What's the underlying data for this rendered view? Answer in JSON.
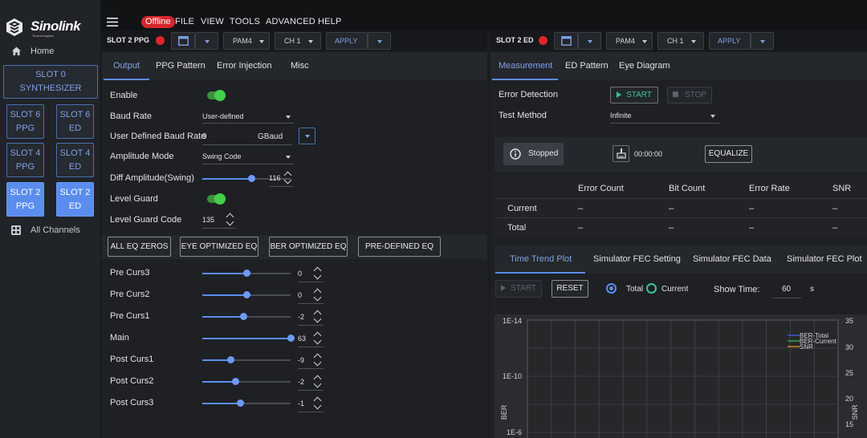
{
  "logo": {
    "name": "Sinolink",
    "tagline": "Technologies"
  },
  "sidebar": {
    "home": "Home",
    "slot0": [
      "SLOT 0",
      "SYNTHESIZER"
    ],
    "slots": [
      {
        "id": "slot6-ppg",
        "l1": "SLOT 6",
        "l2": "PPG",
        "active": false
      },
      {
        "id": "slot6-ed",
        "l1": "SLOT 6",
        "l2": "ED",
        "active": false
      },
      {
        "id": "slot4-ppg",
        "l1": "SLOT 4",
        "l2": "PPG",
        "active": false
      },
      {
        "id": "slot4-ed",
        "l1": "SLOT 4",
        "l2": "ED",
        "active": false
      },
      {
        "id": "slot2-ppg",
        "l1": "SLOT 2",
        "l2": "PPG",
        "active": true
      },
      {
        "id": "slot2-ed",
        "l1": "SLOT 2",
        "l2": "ED",
        "active": true
      }
    ],
    "all_channels": "All Channels"
  },
  "menu": {
    "status": "Offline",
    "items": [
      "FILE",
      "VIEW",
      "TOOLS",
      "ADVANCED",
      "HELP"
    ]
  },
  "ppg_toolbar": {
    "title": "SLOT 2 PPG",
    "modulation": "PAM4",
    "channel": "CH 1",
    "apply": "APPLY"
  },
  "ed_toolbar": {
    "title": "SLOT 2 ED",
    "modulation": "PAM4",
    "channel": "CH 1",
    "apply": "APPLY"
  },
  "ppg": {
    "tabs": [
      "Output",
      "PPG Pattern",
      "Error Injection",
      "Misc"
    ],
    "active_tab": "Output",
    "enable_label": "Enable",
    "baud_rate_label": "Baud Rate",
    "baud_rate_value": "User-defined",
    "user_baud_label": "User Defined Baud Rate",
    "user_baud_value": "9",
    "user_baud_unit": "GBaud",
    "amplitude_mode_label": "Amplitude Mode",
    "amplitude_mode_value": "Swing Code",
    "diff_amp_label": "Diff Amplitude(Swing)",
    "diff_amp_value": "116",
    "diff_amp_level": 0.55,
    "level_guard_label": "Level Guard",
    "level_guard_code_label": "Level Guard Code",
    "level_guard_code_value": "135",
    "eq_buttons": [
      "ALL EQ ZEROS",
      "EYE OPTIMIZED EQ",
      "BER OPTIMIZED EQ",
      "PRE-DEFINED EQ"
    ],
    "taps": [
      {
        "name": "Pre Curs3",
        "value": "0",
        "level": 0.5
      },
      {
        "name": "Pre Curs2",
        "value": "0",
        "level": 0.5
      },
      {
        "name": "Pre Curs1",
        "value": "-2",
        "level": 0.46
      },
      {
        "name": "Main",
        "value": "63",
        "level": 1.0
      },
      {
        "name": "Post Curs1",
        "value": "-9",
        "level": 0.32
      },
      {
        "name": "Post Curs2",
        "value": "-2",
        "level": 0.37
      },
      {
        "name": "Post Curs3",
        "value": "-1",
        "level": 0.43
      }
    ]
  },
  "ed": {
    "tabs": [
      "Measurement",
      "ED Pattern",
      "Eye Diagram"
    ],
    "active_tab": "Measurement",
    "error_detection_label": "Error Detection",
    "start": "START",
    "stop": "STOP",
    "test_method_label": "Test Method",
    "test_method_value": "Infinite",
    "status": "Stopped",
    "timer": "00:00:00",
    "equalize": "EQUALIZE",
    "table": {
      "columns": [
        "Error Count",
        "Bit Count",
        "Error Rate",
        "SNR"
      ],
      "rows": [
        {
          "label": "Current",
          "cells": [
            "–",
            "–",
            "–",
            "–"
          ]
        },
        {
          "label": "Total",
          "cells": [
            "–",
            "–",
            "–",
            "–"
          ]
        }
      ]
    },
    "sub_tabs": [
      "Time Trend Plot",
      "Simulator FEC Setting",
      "Simulator FEC Data",
      "Simulator FEC Plot"
    ],
    "active_sub_tab": "Time Trend Plot",
    "plot_start": "START",
    "reset": "RESET",
    "radio_total": "Total",
    "radio_current": "Current",
    "show_time_label": "Show Time:",
    "show_time_value": "60",
    "show_time_unit": "s"
  },
  "chart_data": {
    "type": "line",
    "title": "",
    "xlabel": "",
    "ylabel": "BER",
    "y2label": "SNR",
    "y_ticks": [
      "1E-14",
      "1E-10",
      "1E-6"
    ],
    "y2_ticks": [
      "35",
      "30",
      "25",
      "20",
      "15"
    ],
    "grid": true,
    "legend_position": "top-right",
    "series": [
      {
        "name": "BER-Total",
        "color": "#3f66ff",
        "values": []
      },
      {
        "name": "BER-Current",
        "color": "#38c94a",
        "values": []
      },
      {
        "name": "SNR",
        "color": "#f0a020",
        "values": []
      }
    ]
  }
}
